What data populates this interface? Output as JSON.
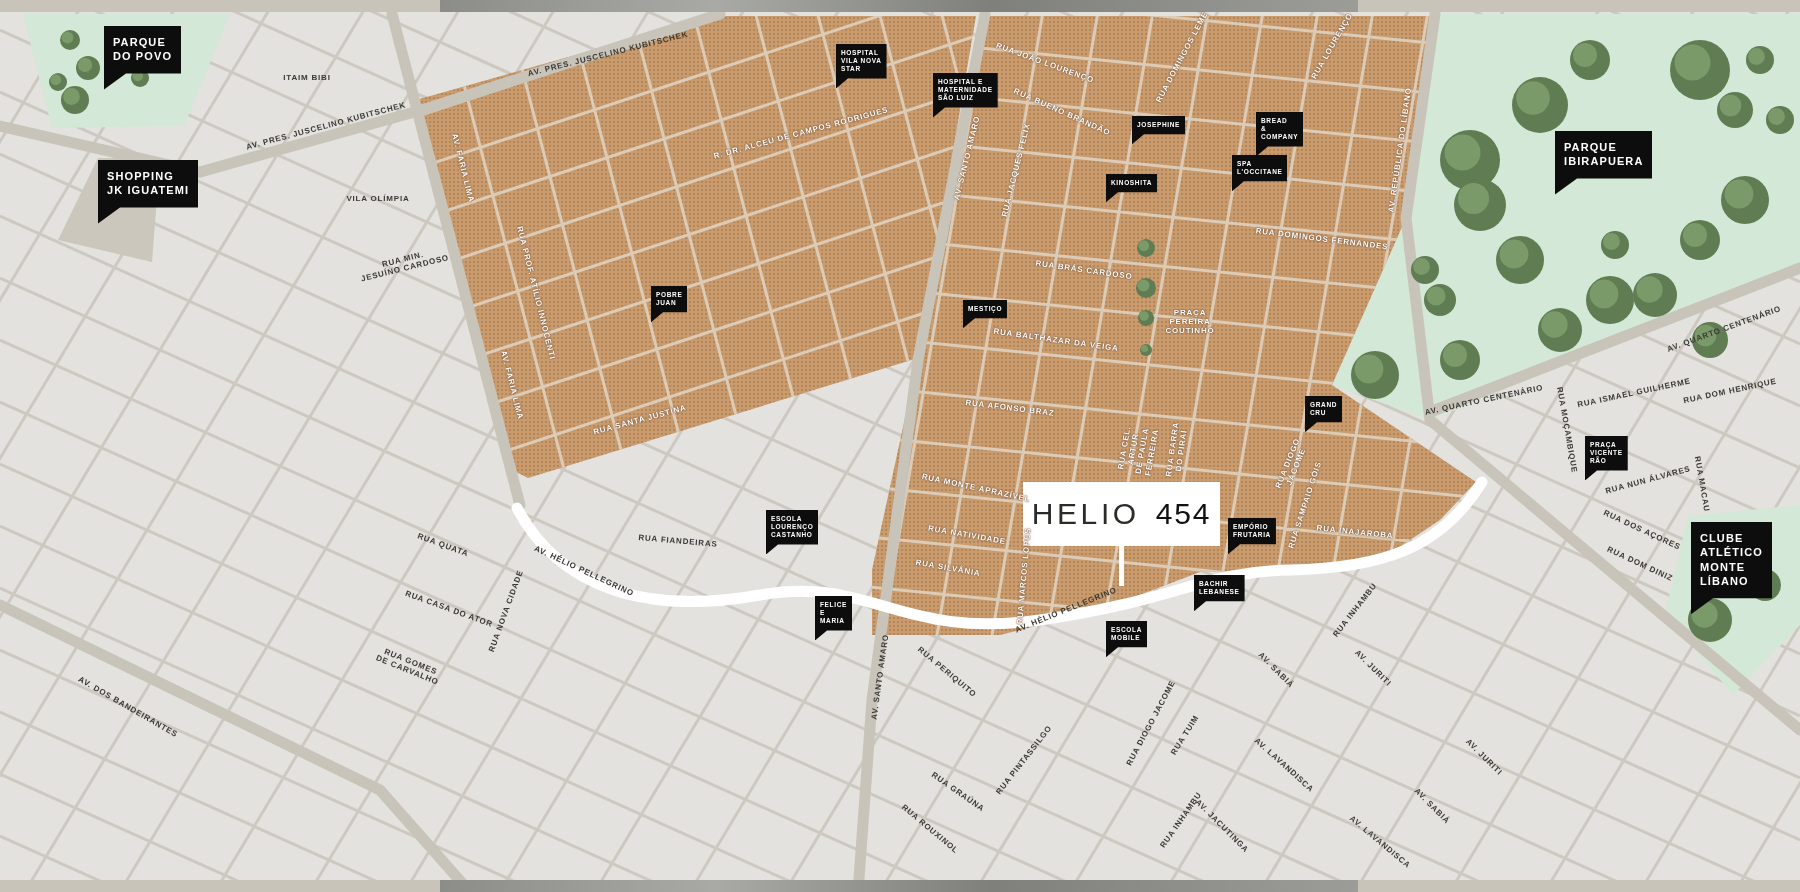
{
  "map": {
    "project_sign": {
      "name": "HELIO",
      "number": "454"
    },
    "places": [
      {
        "kind": "landmark",
        "lines": [
          "PARQUE",
          "DO POVO"
        ]
      },
      {
        "kind": "landmark",
        "lines": [
          "SHOPPING",
          "JK IGUATEMI"
        ]
      },
      {
        "kind": "venue",
        "lines": [
          "HOSPITAL",
          "VILA NOVA",
          "STAR"
        ]
      },
      {
        "kind": "venue",
        "lines": [
          "HOSPITAL E",
          "MATERNIDADE",
          "SÃO LUIZ"
        ]
      },
      {
        "kind": "venue",
        "lines": [
          "JOSEPHINE"
        ]
      },
      {
        "kind": "venue",
        "lines": [
          "BREAD",
          "&",
          "COMPANY"
        ]
      },
      {
        "kind": "venue",
        "lines": [
          "SPA",
          "L'OCCITANE"
        ]
      },
      {
        "kind": "venue",
        "lines": [
          "KINOSHITA"
        ]
      },
      {
        "kind": "landmark",
        "lines": [
          "PARQUE",
          "IBIRAPUERA"
        ]
      },
      {
        "kind": "venue",
        "lines": [
          "POBRE",
          "JUAN"
        ]
      },
      {
        "kind": "venue",
        "lines": [
          "MESTIÇO"
        ]
      },
      {
        "kind": "venue",
        "lines": [
          "GRAND",
          "CRU"
        ]
      },
      {
        "kind": "venue",
        "lines": [
          "PRAÇA",
          "VICENTE",
          "RÃO"
        ]
      },
      {
        "kind": "venue",
        "lines": [
          "ESCOLA",
          "LOURENÇO",
          "CASTANHO"
        ]
      },
      {
        "kind": "venue",
        "lines": [
          "EMPÓRIO",
          "FRUTARIA"
        ]
      },
      {
        "kind": "venue",
        "lines": [
          "BACHIR",
          "LEBANESE"
        ]
      },
      {
        "kind": "venue",
        "lines": [
          "FELICE",
          "E",
          "MARIA"
        ]
      },
      {
        "kind": "venue",
        "lines": [
          "ESCOLA",
          "MOBILE"
        ]
      },
      {
        "kind": "landmark",
        "lines": [
          "CLUBE",
          "ATLÉTICO",
          "MONTE",
          "LÍBANO"
        ]
      }
    ],
    "streets": [
      {
        "kind": "outer",
        "lines": [
          "ITAIM BIBI"
        ]
      },
      {
        "kind": "outer",
        "lines": [
          "AV. PRES. JUSCELINO KUBITSCHEK"
        ]
      },
      {
        "kind": "outer",
        "lines": [
          "AV. PRES. JUSCELINO KUBITSCHEK"
        ]
      },
      {
        "kind": "outer",
        "lines": [
          "VILA OLÍMPIA"
        ]
      },
      {
        "kind": "outer",
        "lines": [
          "RUA MIN.",
          "JESUÍNO CARDOSO"
        ]
      },
      {
        "kind": "inner",
        "lines": [
          "R. DR. ALCEU DE CAMPOS RODRIGUES"
        ]
      },
      {
        "kind": "inner",
        "lines": [
          "AV. FARIA LIMA"
        ]
      },
      {
        "kind": "inner",
        "lines": [
          "RUA PROF. ATÍLIO INNOCENTI"
        ]
      },
      {
        "kind": "inner",
        "lines": [
          "AV. FARIA LIMA"
        ]
      },
      {
        "kind": "inner",
        "lines": [
          "RUA SANTA JUSTINA"
        ]
      },
      {
        "kind": "inner",
        "lines": [
          "RUA JOÃO LOURENÇO"
        ]
      },
      {
        "kind": "inner",
        "lines": [
          "RUA DOMINGOS LEME"
        ]
      },
      {
        "kind": "inner",
        "lines": [
          "RUA LOURENÇO"
        ]
      },
      {
        "kind": "inner",
        "lines": [
          "RUA BUENO BRANDÃO"
        ]
      },
      {
        "kind": "inner",
        "lines": [
          "AV. SANTO AMARO"
        ]
      },
      {
        "kind": "inner",
        "lines": [
          "RUA JACQUES FELIX"
        ]
      },
      {
        "kind": "inner",
        "lines": [
          "AV. REPÚBLICA DO LÍBANO"
        ]
      },
      {
        "kind": "inner",
        "lines": [
          "RUA DOMINGOS FERNANDES"
        ]
      },
      {
        "kind": "inner",
        "lines": [
          "RUA BRÁS CARDOSO"
        ]
      },
      {
        "kind": "inner",
        "lines": [
          "PRAÇA",
          "PEREIRA",
          "COUTINHO"
        ]
      },
      {
        "kind": "inner",
        "lines": [
          "RUA BALTHAZAR DA VEIGA"
        ]
      },
      {
        "kind": "inner",
        "lines": [
          "RUA AFONSO BRAZ"
        ]
      },
      {
        "kind": "inner",
        "lines": [
          "RUA CEL.",
          "ARTUR",
          "DE PAULA",
          "FERREIRA"
        ]
      },
      {
        "kind": "inner",
        "lines": [
          "RUA BARRA",
          "DO PIRAÍ"
        ]
      },
      {
        "kind": "inner",
        "lines": [
          "RUA DIOGO",
          "JÁCOME"
        ]
      },
      {
        "kind": "inner",
        "lines": [
          "RUA SAMPAIO GÓIS"
        ]
      },
      {
        "kind": "inner",
        "lines": [
          "RUA INAJAROBA"
        ]
      },
      {
        "kind": "inner",
        "lines": [
          "RUA MONTE APRAZÍVEL"
        ]
      },
      {
        "kind": "inner",
        "lines": [
          "RUA NATIVIDADE"
        ]
      },
      {
        "kind": "inner",
        "lines": [
          "RUA SILVÂNIA"
        ]
      },
      {
        "kind": "inner",
        "lines": [
          "RUA MARCOS LOPES"
        ]
      },
      {
        "kind": "outer",
        "lines": [
          "RUA QUATA"
        ]
      },
      {
        "kind": "outer",
        "lines": [
          "RUA FIANDEIRAS"
        ]
      },
      {
        "kind": "outer",
        "lines": [
          "AV. HÉLIO PELLEGRINO"
        ]
      },
      {
        "kind": "outer",
        "lines": [
          "RUA CASA DO ATOR"
        ]
      },
      {
        "kind": "outer",
        "lines": [
          "RUA NOVA CIDADE"
        ]
      },
      {
        "kind": "outer",
        "lines": [
          "RUA GOMES",
          "DE CARVALHO"
        ]
      },
      {
        "kind": "outer",
        "lines": [
          "AV. DOS BANDEIRANTES"
        ]
      },
      {
        "kind": "outer",
        "lines": [
          "AV. SANTO AMARO"
        ]
      },
      {
        "kind": "outer",
        "lines": [
          "RUA PERIQUITO"
        ]
      },
      {
        "kind": "outer",
        "lines": [
          "AV. HÉLIO PELLEGRINO"
        ]
      },
      {
        "kind": "outer",
        "lines": [
          "RUA DIOGO JACOME"
        ]
      },
      {
        "kind": "outer",
        "lines": [
          "RUA TUIM"
        ]
      },
      {
        "kind": "outer",
        "lines": [
          "RUA GRAÚNA"
        ]
      },
      {
        "kind": "outer",
        "lines": [
          "RUA PINTASSILGO"
        ]
      },
      {
        "kind": "outer",
        "lines": [
          "RUA ROUXINOL"
        ]
      },
      {
        "kind": "outer",
        "lines": [
          "RUA INHAMBU"
        ]
      },
      {
        "kind": "outer",
        "lines": [
          "AV. JACUTINGA"
        ]
      },
      {
        "kind": "outer",
        "lines": [
          "AV. LAVANDISCA"
        ]
      },
      {
        "kind": "outer",
        "lines": [
          "AV. LAVANDISCA"
        ]
      },
      {
        "kind": "outer",
        "lines": [
          "AV. SABIÁ"
        ]
      },
      {
        "kind": "outer",
        "lines": [
          "AV. SABIÁ"
        ]
      },
      {
        "kind": "outer",
        "lines": [
          "AV. JURITI"
        ]
      },
      {
        "kind": "outer",
        "lines": [
          "AV. JURITI"
        ]
      },
      {
        "kind": "outer",
        "lines": [
          "RUA INHAMBU"
        ]
      },
      {
        "kind": "outer",
        "lines": [
          "RUA DOS AÇORES"
        ]
      },
      {
        "kind": "outer",
        "lines": [
          "RUA DOM DINIZ"
        ]
      },
      {
        "kind": "outer",
        "lines": [
          "RUA MACAU"
        ]
      },
      {
        "kind": "outer",
        "lines": [
          "RUA NUN ÁLVARES"
        ]
      },
      {
        "kind": "outer",
        "lines": [
          "RUA MOÇAMBIQUE"
        ]
      },
      {
        "kind": "outer",
        "lines": [
          "RUA ISMAEL GUILHERME"
        ]
      },
      {
        "kind": "outer",
        "lines": [
          "RUA DOM HENRIQUE"
        ]
      },
      {
        "kind": "outer",
        "lines": [
          "AV. QUARTO CENTENÁRIO"
        ]
      },
      {
        "kind": "outer",
        "lines": [
          "AV. QUARTO CENTENÁRIO"
        ]
      }
    ]
  }
}
